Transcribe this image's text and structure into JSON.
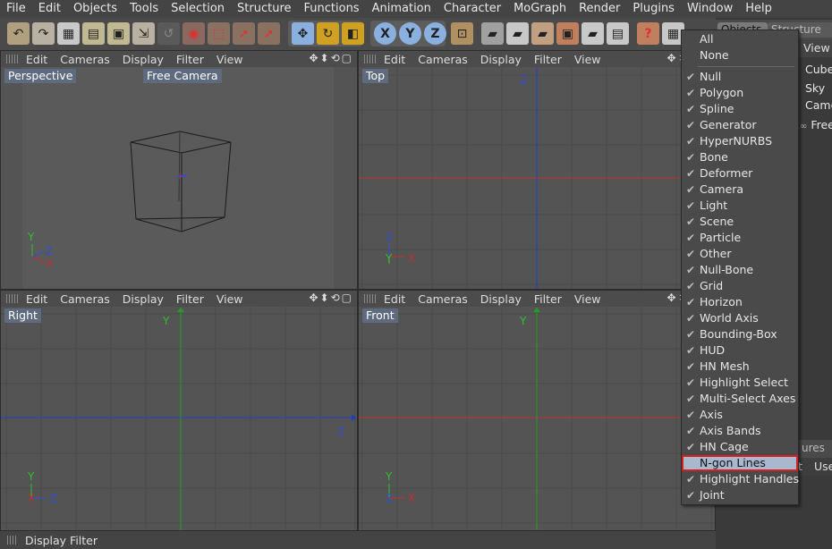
{
  "menubar": [
    "File",
    "Edit",
    "Objects",
    "Tools",
    "Selection",
    "Structure",
    "Functions",
    "Animation",
    "Character",
    "MoGraph",
    "Render",
    "Plugins",
    "Window",
    "Help"
  ],
  "viewport_menu": [
    "Edit",
    "Cameras",
    "Display",
    "Filter",
    "View"
  ],
  "viewports": {
    "perspective": {
      "label": "Perspective",
      "camera": "Free Camera"
    },
    "top": {
      "label": "Top"
    },
    "right": {
      "label": "Right"
    },
    "front": {
      "label": "Front"
    }
  },
  "axes": {
    "x": "X",
    "y": "Y",
    "z": "Z"
  },
  "status": {
    "text": "Display Filter"
  },
  "right_panel": {
    "tabs": [
      "Objects",
      "Structure"
    ],
    "view_label": "View",
    "objects": [
      "Cube",
      "Sky",
      "Came",
      "Free"
    ],
    "lower_tabs": [
      "ures"
    ],
    "lower_items": [
      "t",
      "Use"
    ]
  },
  "dropdown": {
    "top_items": [
      "All",
      "None"
    ],
    "items": [
      {
        "label": "Null",
        "checked": true
      },
      {
        "label": "Polygon",
        "checked": true
      },
      {
        "label": "Spline",
        "checked": true
      },
      {
        "label": "Generator",
        "checked": true
      },
      {
        "label": "HyperNURBS",
        "checked": true
      },
      {
        "label": "Bone",
        "checked": true
      },
      {
        "label": "Deformer",
        "checked": true
      },
      {
        "label": "Camera",
        "checked": true
      },
      {
        "label": "Light",
        "checked": true
      },
      {
        "label": "Scene",
        "checked": true
      },
      {
        "label": "Particle",
        "checked": true
      },
      {
        "label": "Other",
        "checked": true
      },
      {
        "label": "Null-Bone",
        "checked": true
      },
      {
        "label": "Grid",
        "checked": true
      },
      {
        "label": "Horizon",
        "checked": true
      },
      {
        "label": "World Axis",
        "checked": true
      },
      {
        "label": "Bounding-Box",
        "checked": true
      },
      {
        "label": "HUD",
        "checked": true
      },
      {
        "label": "HN Mesh",
        "checked": true
      },
      {
        "label": "Highlight Select",
        "checked": true
      },
      {
        "label": "Multi-Select Axes",
        "checked": true
      },
      {
        "label": "Axis",
        "checked": true
      },
      {
        "label": "Axis Bands",
        "checked": true
      },
      {
        "label": "HN Cage",
        "checked": true
      },
      {
        "label": "N-gon Lines",
        "checked": false,
        "highlighted": true
      },
      {
        "label": "Highlight Handles",
        "checked": true
      },
      {
        "label": "Joint",
        "checked": true
      }
    ]
  },
  "colors": {
    "x_axis": "#c03030",
    "y_axis": "#30c030",
    "z_axis": "#3050d0",
    "highlight": "#a9b7cf",
    "focus_border": "#d62020"
  }
}
